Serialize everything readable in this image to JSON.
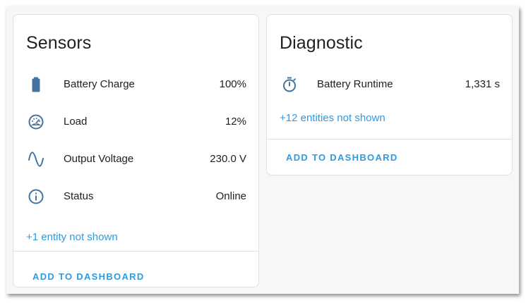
{
  "sensors_card": {
    "title": "Sensors",
    "rows": [
      {
        "icon": "battery-icon",
        "label": "Battery Charge",
        "value": "100%"
      },
      {
        "icon": "gauge-icon",
        "label": "Load",
        "value": "12%"
      },
      {
        "icon": "sine-wave-icon",
        "label": "Output Voltage",
        "value": "230.0 V"
      },
      {
        "icon": "info-icon",
        "label": "Status",
        "value": "Online"
      }
    ],
    "more_link": "+1 entity not shown",
    "action": "ADD TO DASHBOARD"
  },
  "diagnostic_card": {
    "title": "Diagnostic",
    "rows": [
      {
        "icon": "timer-icon",
        "label": "Battery Runtime",
        "value": "1,331 s"
      }
    ],
    "more_link": "+12 entities not shown",
    "action": "ADD TO DASHBOARD"
  },
  "colors": {
    "icon": "#44739e",
    "link": "#2f9be0",
    "text": "#212121"
  }
}
